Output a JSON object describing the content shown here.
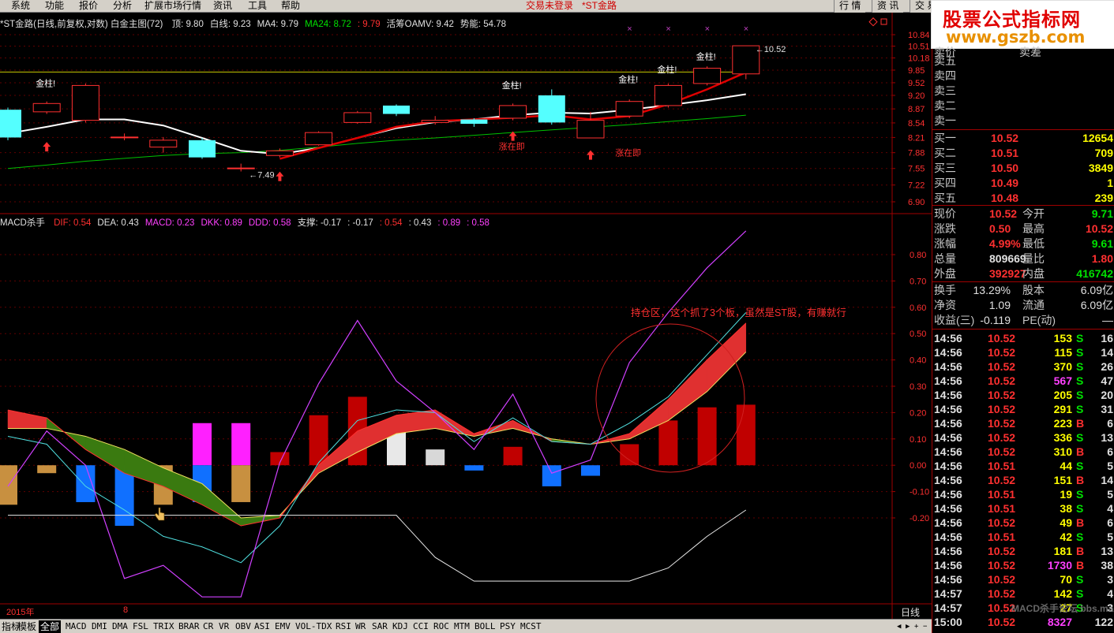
{
  "menu": {
    "items": [
      "系统",
      "功能",
      "报价",
      "分析",
      "扩展市场行情",
      "资讯",
      "工具",
      "帮助"
    ],
    "login_status": "交易未登录",
    "stock_tag": "*ST金路",
    "right_buttons": [
      "行 情",
      "资 讯",
      "交 易"
    ]
  },
  "logo": {
    "line1": "股票公式指标网",
    "line2": "www.gszb.com"
  },
  "price_header": {
    "title": "*ST金路(日线,前复权,对数) 白金主图(72)",
    "items": [
      {
        "text": "顶: 9.80",
        "color": "#e0e0e0"
      },
      {
        "text": "白线: 9.23",
        "color": "#e0e0e0"
      },
      {
        "text": "MA4: 9.79",
        "color": "#e0e0e0"
      },
      {
        "text": "MA24: 8.72",
        "color": "#00e000"
      },
      {
        "text": ": 9.79",
        "color": "#ff3030"
      },
      {
        "text": "活筹OAMV: 9.42",
        "color": "#e0e0e0"
      },
      {
        "text": "势能: 54.78",
        "color": "#e0e0e0"
      }
    ]
  },
  "indicator_header": {
    "title": "MACD杀手",
    "items": [
      {
        "text": "DIF: 0.54",
        "color": "#ff3030"
      },
      {
        "text": "DEA: 0.43",
        "color": "#e0e0e0"
      },
      {
        "text": "MACD: 0.23",
        "color": "#ff40ff"
      },
      {
        "text": "DKK: 0.89",
        "color": "#ff40ff"
      },
      {
        "text": "DDD: 0.58",
        "color": "#ff40ff"
      },
      {
        "text": "支撑: -0.17",
        "color": "#e0e0e0"
      },
      {
        "text": ": -0.17",
        "color": "#e0e0e0"
      },
      {
        "text": ": 0.54",
        "color": "#ff3030"
      },
      {
        "text": ": 0.43",
        "color": "#e0e0e0"
      },
      {
        "text": ": 0.89",
        "color": "#ff40ff"
      },
      {
        "text": ": 0.58",
        "color": "#ff40ff"
      }
    ]
  },
  "price_axis": [
    "10.84",
    "10.51",
    "10.18",
    "9.85",
    "9.52",
    "9.20",
    "8.87",
    "8.54",
    "8.21",
    "7.88",
    "7.55",
    "7.22",
    "6.90"
  ],
  "indicator_axis": [
    "0.80",
    "0.70",
    "0.60",
    "0.50",
    "0.40",
    "0.30",
    "0.20",
    "0.10",
    "0.00",
    "-0.10",
    "-0.20"
  ],
  "annotations": {
    "gold_label": "金柱!",
    "rise_label": "涨在即",
    "low_price": "7.49",
    "high_price": "10.52",
    "position_note": "持仓区，这个抓了3个板，虽然是ST股，有赚就行"
  },
  "date_axis": {
    "year": "2015年",
    "month": "8",
    "period": "日线"
  },
  "quote": {
    "sell_header": [
      "卖价",
      "卖差"
    ],
    "sells": [
      {
        "label": "卖五"
      },
      {
        "label": "卖四"
      },
      {
        "label": "卖三"
      },
      {
        "label": "卖二"
      },
      {
        "label": "卖一"
      }
    ],
    "buys": [
      {
        "label": "买一",
        "price": "10.52",
        "vol": "12654"
      },
      {
        "label": "买二",
        "price": "10.51",
        "vol": "709"
      },
      {
        "label": "买三",
        "price": "10.50",
        "vol": "3849"
      },
      {
        "label": "买四",
        "price": "10.49",
        "vol": "1"
      },
      {
        "label": "买五",
        "price": "10.48",
        "vol": "239"
      }
    ],
    "stats": [
      {
        "l1": "现价",
        "v1": "10.52",
        "c1": "#ff3030",
        "l2": "今开",
        "v2": "9.71",
        "c2": "#00e000"
      },
      {
        "l1": "涨跌",
        "v1": "0.50",
        "c1": "#ff3030",
        "l2": "最高",
        "v2": "10.52",
        "c2": "#ff3030"
      },
      {
        "l1": "涨幅",
        "v1": "4.99%",
        "c1": "#ff3030",
        "l2": "最低",
        "v2": "9.61",
        "c2": "#00e000"
      },
      {
        "l1": "总量",
        "v1": "809669",
        "c1": "#e0e0e0",
        "l2": "量比",
        "v2": "1.80",
        "c2": "#ff3030"
      },
      {
        "l1": "外盘",
        "v1": "392927",
        "c1": "#ff3030",
        "l2": "内盘",
        "v2": "416742",
        "c2": "#00e000"
      }
    ],
    "fundamentals": [
      {
        "l1": "换手",
        "v1": "13.29%",
        "l2": "股本",
        "v2": "6.09亿"
      },
      {
        "l1": "净资",
        "v1": "1.09",
        "l2": "流通",
        "v2": "6.09亿"
      },
      {
        "l1": "收益(三)",
        "v1": "-0.119",
        "l2": "PE(动)",
        "v2": "—"
      }
    ]
  },
  "ticks": [
    {
      "time": "14:56",
      "price": "10.52",
      "vol": "153",
      "side": "S",
      "n": "16"
    },
    {
      "time": "14:56",
      "price": "10.52",
      "vol": "115",
      "side": "S",
      "n": "14"
    },
    {
      "time": "14:56",
      "price": "10.52",
      "vol": "370",
      "side": "S",
      "n": "26"
    },
    {
      "time": "14:56",
      "price": "10.52",
      "vol": "567",
      "side": "S",
      "n": "47"
    },
    {
      "time": "14:56",
      "price": "10.52",
      "vol": "205",
      "side": "S",
      "n": "20"
    },
    {
      "time": "14:56",
      "price": "10.52",
      "vol": "291",
      "side": "S",
      "n": "31"
    },
    {
      "time": "14:56",
      "price": "10.52",
      "vol": "223",
      "side": "B",
      "n": "6"
    },
    {
      "time": "14:56",
      "price": "10.52",
      "vol": "336",
      "side": "S",
      "n": "13"
    },
    {
      "time": "14:56",
      "price": "10.52",
      "vol": "310",
      "side": "B",
      "n": "6"
    },
    {
      "time": "14:56",
      "price": "10.51",
      "vol": "44",
      "side": "S",
      "n": "5"
    },
    {
      "time": "14:56",
      "price": "10.52",
      "vol": "151",
      "side": "B",
      "n": "14"
    },
    {
      "time": "14:56",
      "price": "10.51",
      "vol": "19",
      "side": "S",
      "n": "5"
    },
    {
      "time": "14:56",
      "price": "10.51",
      "vol": "38",
      "side": "S",
      "n": "4"
    },
    {
      "time": "14:56",
      "price": "10.52",
      "vol": "49",
      "side": "B",
      "n": "6"
    },
    {
      "time": "14:56",
      "price": "10.51",
      "vol": "42",
      "side": "S",
      "n": "5"
    },
    {
      "time": "14:56",
      "price": "10.52",
      "vol": "181",
      "side": "B",
      "n": "13"
    },
    {
      "time": "14:56",
      "price": "10.52",
      "vol": "1730",
      "side": "B",
      "n": "38"
    },
    {
      "time": "14:56",
      "price": "10.52",
      "vol": "70",
      "side": "S",
      "n": "3"
    },
    {
      "time": "14:57",
      "price": "10.52",
      "vol": "142",
      "side": "S",
      "n": "4"
    },
    {
      "time": "14:57",
      "price": "10.52",
      "vol": "27",
      "side": "S",
      "n": "3"
    },
    {
      "time": "15:00",
      "price": "10.52",
      "vol": "8327",
      "side": "",
      "n": "122"
    }
  ],
  "watermark_bottom": "MACD杀手论坛 bbs.macd.net",
  "tabs": [
    "指标",
    "模板",
    "全部",
    "MACD",
    "DMI",
    "DMA",
    "FSL",
    "TRIX",
    "BRAR",
    "CR",
    "VR",
    "OBV",
    "ASI",
    "EMV",
    "VOL-TDX",
    "RSI",
    "WR",
    "SAR",
    "KDJ",
    "CCI",
    "ROC",
    "MTM",
    "BOLL",
    "PSY",
    "MCST"
  ],
  "active_tab": "全部",
  "candles": [
    {
      "o": 8.85,
      "c": 8.21,
      "h": 8.9,
      "l": 8.15
    },
    {
      "o": 8.8,
      "c": 9.0,
      "h": 9.05,
      "l": 8.75
    },
    {
      "o": 8.6,
      "c": 9.45,
      "h": 9.5,
      "l": 8.55
    },
    {
      "o": 8.22,
      "c": 8.22,
      "h": 8.3,
      "l": 8.15
    },
    {
      "o": 8.0,
      "c": 8.15,
      "h": 8.22,
      "l": 7.88
    },
    {
      "o": 8.15,
      "c": 7.78,
      "h": 8.2,
      "l": 7.75
    },
    {
      "o": 7.56,
      "c": 7.56,
      "h": 7.65,
      "l": 7.49
    },
    {
      "o": 7.82,
      "c": 7.92,
      "h": 7.97,
      "l": 7.78
    },
    {
      "o": 8.05,
      "c": 8.32,
      "h": 8.35,
      "l": 8.03
    },
    {
      "o": 8.55,
      "c": 8.78,
      "h": 8.82,
      "l": 8.52
    },
    {
      "o": 8.95,
      "c": 8.75,
      "h": 8.98,
      "l": 8.7
    },
    {
      "o": 8.55,
      "c": 8.6,
      "h": 8.7,
      "l": 8.5
    },
    {
      "o": 8.62,
      "c": 8.52,
      "h": 8.65,
      "l": 8.45
    },
    {
      "o": 8.65,
      "c": 8.95,
      "h": 9.0,
      "l": 8.6
    },
    {
      "o": 9.2,
      "c": 8.55,
      "h": 9.35,
      "l": 8.5
    },
    {
      "o": 8.2,
      "c": 8.6,
      "h": 8.8,
      "l": 8.2
    },
    {
      "o": 8.7,
      "c": 9.05,
      "h": 9.1,
      "l": 8.65
    },
    {
      "o": 8.95,
      "c": 9.45,
      "h": 9.5,
      "l": 8.9
    },
    {
      "o": 9.5,
      "c": 9.9,
      "h": 9.95,
      "l": 9.45
    },
    {
      "o": 9.75,
      "c": 10.52,
      "h": 10.52,
      "l": 9.61
    }
  ],
  "macd_bars": [
    -0.15,
    -0.03,
    -0.14,
    -0.23,
    -0.15,
    0.16,
    0.16,
    0.05,
    0.19,
    0.26,
    0.14,
    0.06,
    -0.02,
    0.07,
    -0.08,
    -0.04,
    0.08,
    0.17,
    0.22,
    0.23
  ],
  "dif": [
    0.21,
    0.18,
    0.06,
    -0.03,
    -0.08,
    -0.15,
    -0.23,
    -0.2,
    0.0,
    0.13,
    0.19,
    0.21,
    0.12,
    0.17,
    0.09,
    0.08,
    0.12,
    0.25,
    0.4,
    0.54
  ],
  "dea": [
    0.14,
    0.14,
    0.11,
    0.06,
    -0.01,
    -0.07,
    -0.2,
    -0.19,
    -0.03,
    0.05,
    0.12,
    0.14,
    0.11,
    0.14,
    0.1,
    0.08,
    0.1,
    0.17,
    0.28,
    0.43
  ],
  "dkk": [
    -0.08,
    0.13,
    0.0,
    -0.43,
    -0.38,
    -0.5,
    -0.5,
    0.01,
    0.31,
    0.55,
    0.32,
    0.2,
    0.06,
    0.27,
    -0.03,
    0.02,
    0.39,
    0.58,
    0.75,
    0.89
  ],
  "ddd": [
    0.11,
    0.08,
    -0.08,
    -0.17,
    -0.27,
    -0.31,
    -0.37,
    -0.23,
    0.01,
    0.17,
    0.21,
    0.2,
    0.09,
    0.18,
    0.09,
    0.08,
    0.16,
    0.26,
    0.42,
    0.58
  ],
  "support": [
    -0.19,
    -0.19,
    -0.19,
    -0.19,
    -0.19,
    -0.19,
    -0.19,
    -0.19,
    -0.19,
    -0.19,
    -0.19,
    -0.35,
    -0.44,
    -0.44,
    -0.44,
    -0.44,
    -0.44,
    -0.39,
    -0.27,
    -0.17
  ]
}
